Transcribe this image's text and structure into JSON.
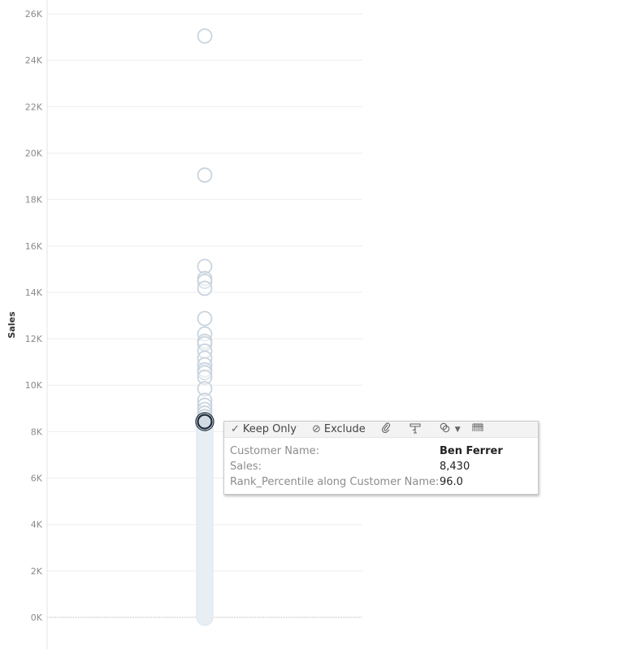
{
  "chart_data": {
    "type": "scatter",
    "ylabel": "Sales",
    "ylim": [
      0,
      26000
    ],
    "y_ticks": [
      0,
      2000,
      4000,
      6000,
      8000,
      10000,
      12000,
      14000,
      16000,
      18000,
      20000,
      22000,
      24000,
      26000
    ],
    "y_tick_labels": [
      "0K",
      "2K",
      "4K",
      "6K",
      "8K",
      "10K",
      "12K",
      "14K",
      "16K",
      "18K",
      "20K",
      "22K",
      "24K",
      "26K"
    ],
    "grid": true,
    "points": [
      {
        "y": 25043
      },
      {
        "y": 19052
      },
      {
        "y": 15117
      },
      {
        "y": 14596
      },
      {
        "y": 14473
      },
      {
        "y": 14175
      },
      {
        "y": 12873
      },
      {
        "y": 12209
      },
      {
        "y": 11892
      },
      {
        "y": 11790
      },
      {
        "y": 11471
      },
      {
        "y": 11165
      },
      {
        "y": 10880
      },
      {
        "y": 10663
      },
      {
        "y": 10540
      },
      {
        "y": 10344
      },
      {
        "y": 9850
      },
      {
        "y": 9350
      },
      {
        "y": 9135
      },
      {
        "y": 8954
      },
      {
        "y": 8800
      },
      {
        "y": 8650
      },
      {
        "y": 8430,
        "highlighted": true
      }
    ],
    "dense_range": [
      0,
      8300
    ],
    "colors": {
      "marker": "#c9d4de",
      "dense_fill": "#e7eef4",
      "highlight": "#1b2a3a",
      "grid": "#eeeeee"
    }
  },
  "tooltip": {
    "actions": {
      "keep_only": "Keep Only",
      "exclude": "Exclude"
    },
    "icons": [
      "check-icon",
      "exclude-icon",
      "paperclip-icon",
      "group-members-icon",
      "sets-icon",
      "dropdown-arrow-icon",
      "view-data-icon"
    ],
    "rows": [
      {
        "label": "Customer Name:",
        "value": "Ben Ferrer"
      },
      {
        "label": "Sales:",
        "value": "8,430"
      },
      {
        "label": "Rank_Percentile along Customer Name:",
        "value": "96.0"
      }
    ]
  }
}
